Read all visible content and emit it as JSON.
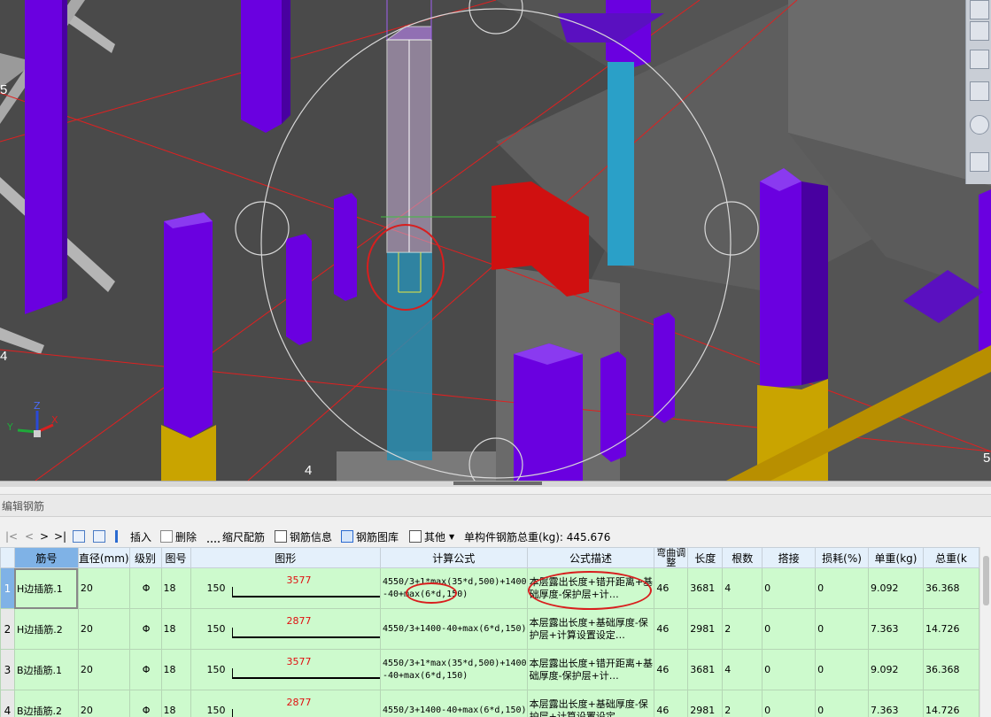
{
  "viewport": {
    "axis_labels": [
      "5",
      "4",
      "4",
      "5"
    ],
    "gizmo": {
      "x": "X",
      "y": "Y",
      "z": "Z"
    },
    "icons": [
      "toolbar-tool-icon"
    ]
  },
  "panel": {
    "title": "编辑钢筋"
  },
  "toolbar": {
    "nav": [
      "|<",
      "<",
      ">",
      ">|"
    ],
    "insert": "插入",
    "delete": "删除",
    "scale_rebar": "缩尺配筋",
    "rebar_info": "钢筋信息",
    "rebar_library": "钢筋图库",
    "other": "其他",
    "total_weight": "单构件钢筋总重(kg): 445.676"
  },
  "table": {
    "columns": [
      "筋号",
      "直径(mm)",
      "级别",
      "图号",
      "图形",
      "计算公式",
      "公式描述",
      "弯曲调整",
      "长度",
      "根数",
      "搭接",
      "损耗(%)",
      "单重(kg)",
      "总重(k"
    ],
    "rows": [
      {
        "num": "1",
        "name": "H边插筋.1",
        "dia": "20",
        "grade": "Φ",
        "fig": "18",
        "hook": "150",
        "shape_len": "3577",
        "formula": "4550/3+1*max(35*d,500)+1400-40+max(6*d,150)",
        "desc": "本层露出长度+错开距离+基础厚度-保护层+计…",
        "bend": "46",
        "length": "3681",
        "count": "4",
        "lap": "0",
        "loss": "0",
        "unit_w": "9.092",
        "total_w": "36.368"
      },
      {
        "num": "2",
        "name": "H边插筋.2",
        "dia": "20",
        "grade": "Φ",
        "fig": "18",
        "hook": "150",
        "shape_len": "2877",
        "formula": "4550/3+1400-40+max(6*d,150)",
        "desc": "本层露出长度+基础厚度-保护层+计算设置设定…",
        "bend": "46",
        "length": "2981",
        "count": "2",
        "lap": "0",
        "loss": "0",
        "unit_w": "7.363",
        "total_w": "14.726"
      },
      {
        "num": "3",
        "name": "B边插筋.1",
        "dia": "20",
        "grade": "Φ",
        "fig": "18",
        "hook": "150",
        "shape_len": "3577",
        "formula": "4550/3+1*max(35*d,500)+1400-40+max(6*d,150)",
        "desc": "本层露出长度+错开距离+基础厚度-保护层+计…",
        "bend": "46",
        "length": "3681",
        "count": "4",
        "lap": "0",
        "loss": "0",
        "unit_w": "9.092",
        "total_w": "36.368"
      },
      {
        "num": "4",
        "name": "B边插筋.2",
        "dia": "20",
        "grade": "Φ",
        "fig": "18",
        "hook": "150",
        "shape_len": "2877",
        "formula": "4550/3+1400-40+max(6*d,150)",
        "desc": "本层露出长度+基础厚度-保护层+计算设置设定…",
        "bend": "46",
        "length": "2981",
        "count": "2",
        "lap": "0",
        "loss": "0",
        "unit_w": "7.363",
        "total_w": "14.726"
      }
    ]
  },
  "colors": {
    "row_bg": "#cdfacd",
    "header_bg": "#e4f0fb",
    "selected": "#7fb2e6",
    "column_purple": "#6a00e0",
    "highlight_red": "#d81e1e"
  }
}
